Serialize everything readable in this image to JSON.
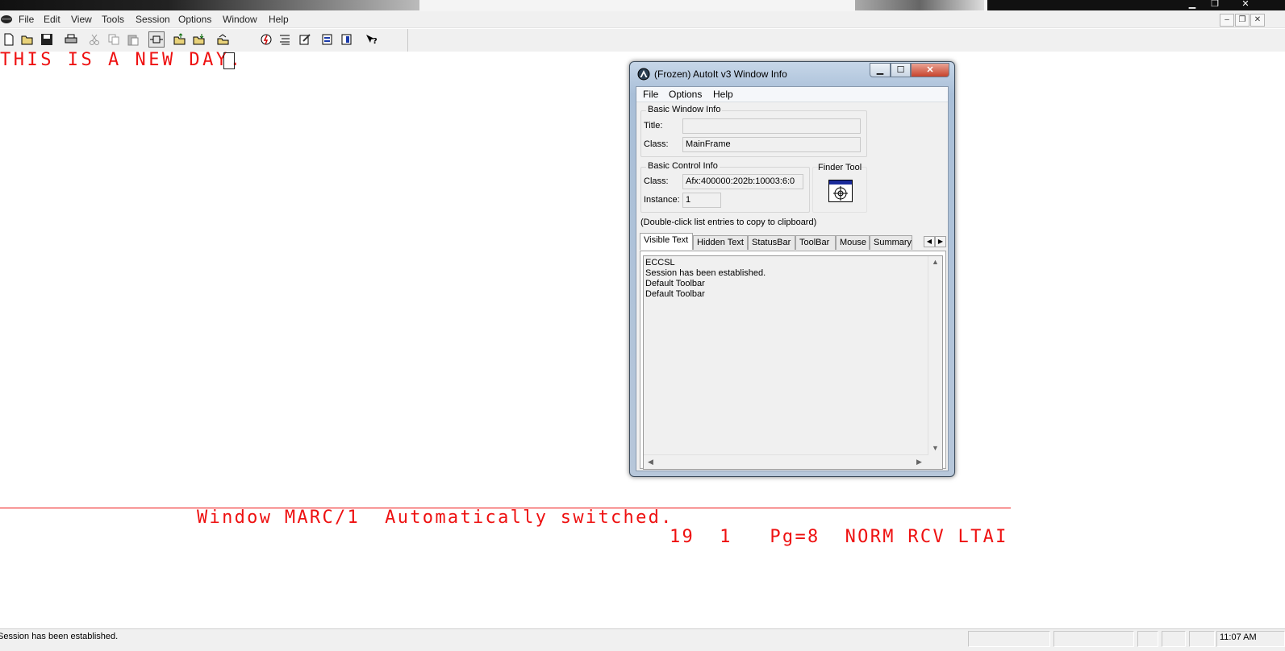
{
  "menubar": {
    "items": [
      "File",
      "Edit",
      "View",
      "Tools",
      "Session",
      "Options",
      "Window",
      "Help"
    ]
  },
  "terminal": {
    "line1": "THIS IS A NEW DAY.",
    "message": "Window MARC/1  Automatically switched.",
    "oia": "19  1   Pg=8  NORM RCV LTAI",
    "text_color": "#ee1111"
  },
  "statusbar": {
    "text": "Session has been established.",
    "time": "11:07 AM"
  },
  "autoit": {
    "title": "(Frozen) AutoIt v3 Window Info",
    "menu": [
      "File",
      "Options",
      "Help"
    ],
    "basic_window": {
      "group_label": "Basic Window Info",
      "title_label": "Title:",
      "title_value": "",
      "class_label": "Class:",
      "class_value": "MainFrame"
    },
    "basic_control": {
      "group_label": "Basic Control Info",
      "class_label": "Class:",
      "class_value": "Afx:400000:202b:10003:6:0",
      "instance_label": "Instance:",
      "instance_value": "1"
    },
    "finder_tool": {
      "label": "Finder Tool",
      "icon": "crosshair-icon"
    },
    "hint": "(Double-click list entries to copy to clipboard)",
    "tabs": [
      "Visible Text",
      "Hidden Text",
      "StatusBar",
      "ToolBar",
      "Mouse",
      "Summary"
    ],
    "active_tab": "Visible Text",
    "list_items": [
      "ECCSL",
      "Session has been established.",
      "Default Toolbar",
      "Default Toolbar"
    ]
  }
}
